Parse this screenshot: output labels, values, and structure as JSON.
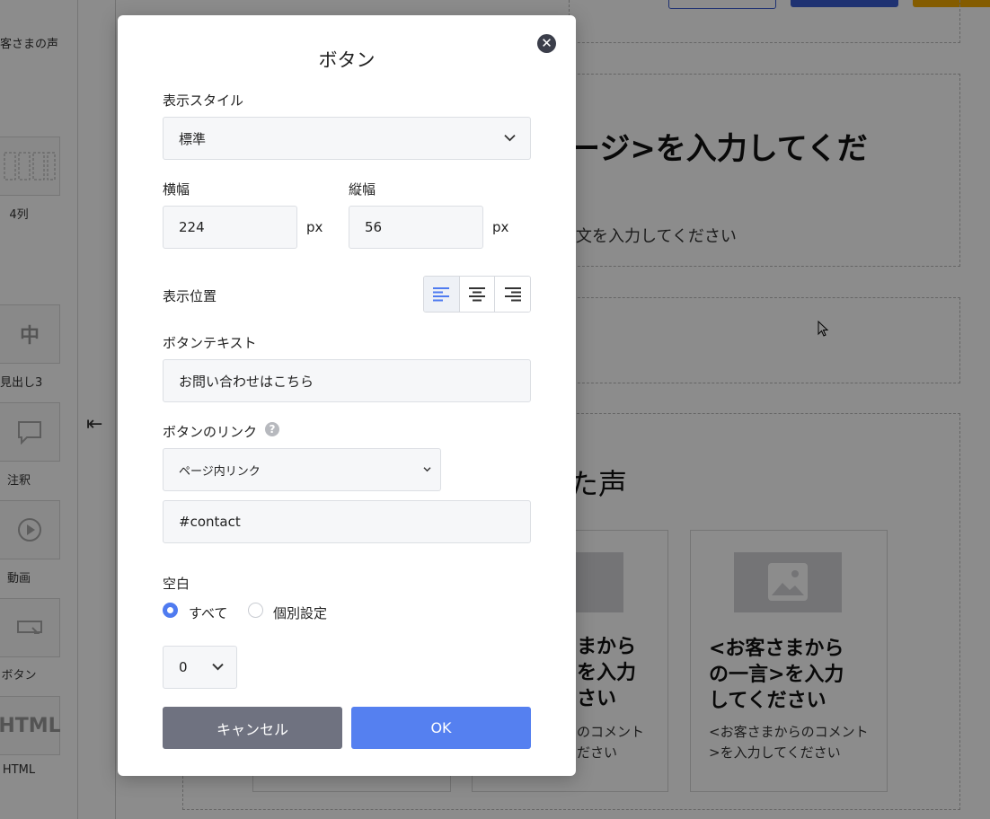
{
  "background": {
    "sidebar": {
      "items": [
        {
          "label": "客さまの声"
        },
        {
          "label": "4列"
        },
        {
          "label": "見出し3",
          "tile_text": "中"
        },
        {
          "label": "注釈"
        },
        {
          "label": "動画"
        },
        {
          "label": "ボタン"
        },
        {
          "label": "HTML",
          "tile_text": "HTML"
        }
      ],
      "collapse_icon": "arrow-left-to-bar-icon"
    },
    "canvas": {
      "heading_fragment": "ージ>を入力してくだ",
      "text_fragment": "文を入力してください",
      "section_heading_fragment": "た声",
      "cards": [
        {
          "title_lines": [
            "まから",
            "を入力",
            "さい"
          ],
          "comment_lines": [
            "のコメント",
            "ださい"
          ]
        },
        {
          "title_lines": [
            "<お客さまから",
            "の一言>を入力",
            "してください"
          ],
          "comment_lines": [
            "<お客さまからのコメント",
            ">を入力してください"
          ]
        }
      ]
    }
  },
  "modal": {
    "title": "ボタン",
    "close_icon": "close-icon",
    "display_style": {
      "label": "表示スタイル",
      "value": "標準"
    },
    "width": {
      "label": "横幅",
      "value": "224",
      "unit": "px"
    },
    "height": {
      "label": "縦幅",
      "value": "56",
      "unit": "px"
    },
    "position": {
      "label": "表示位置",
      "options": [
        "left-align-icon",
        "center-align-icon",
        "right-align-icon"
      ],
      "selected": "left"
    },
    "button_text": {
      "label": "ボタンテキスト",
      "value": "お問い合わせはこちら"
    },
    "link": {
      "label": "ボタンのリンク",
      "help": "?",
      "type": "ページ内リンク",
      "value": "#contact"
    },
    "spacing": {
      "label": "空白",
      "options": [
        "すべて",
        "個別設定"
      ],
      "selected": "すべて",
      "value": "0"
    },
    "cancel_label": "キャンセル",
    "ok_label": "OK"
  },
  "colors": {
    "primary": "#5580f0",
    "cancel": "#6f7280",
    "overlay": "rgba(0,0,0,0.45)"
  }
}
